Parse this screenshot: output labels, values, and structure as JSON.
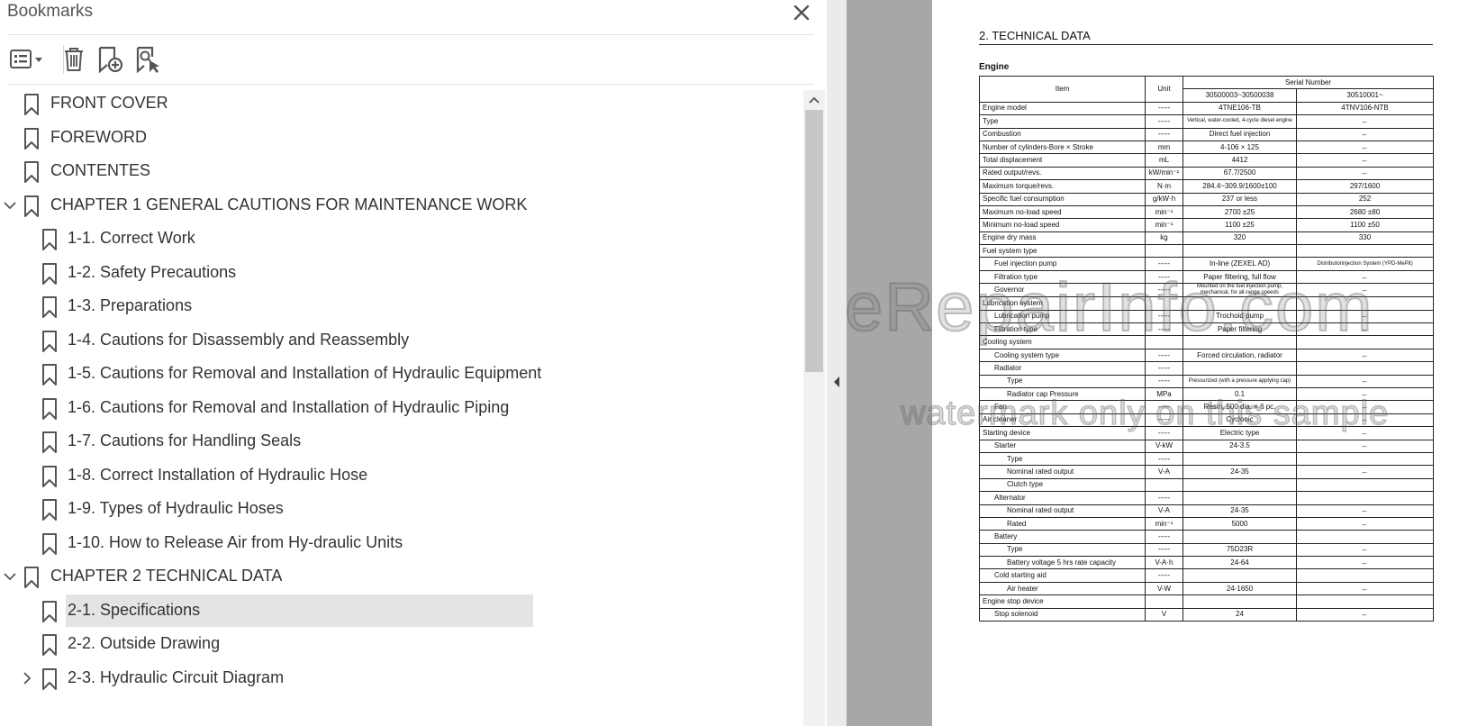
{
  "panel": {
    "title": "Bookmarks",
    "toolbar": {
      "options_icon": "bookmark-options-icon",
      "delete_icon": "trash-icon",
      "add_icon": "add-bookmark-icon",
      "find_icon": "find-current-bookmark-icon"
    },
    "items": [
      {
        "label": "FRONT COVER",
        "level": 0,
        "expander": "none",
        "selected": false
      },
      {
        "label": "FOREWORD",
        "level": 0,
        "expander": "none",
        "selected": false
      },
      {
        "label": "CONTENTES",
        "level": 0,
        "expander": "none",
        "selected": false
      },
      {
        "label": "CHAPTER 1 GENERAL CAUTIONS FOR MAINTENANCE WORK",
        "level": 0,
        "expander": "expanded",
        "selected": false
      },
      {
        "label": "1-1. Correct Work",
        "level": 1,
        "expander": "none",
        "selected": false
      },
      {
        "label": "1-2. Safety Precautions",
        "level": 1,
        "expander": "none",
        "selected": false
      },
      {
        "label": "1-3. Preparations",
        "level": 1,
        "expander": "none",
        "selected": false
      },
      {
        "label": "1-4. Cautions for Disassembly and Reassembly",
        "level": 1,
        "expander": "none",
        "selected": false
      },
      {
        "label": "1-5. Cautions for Removal and Installation of Hydraulic Equipment",
        "level": 1,
        "expander": "none",
        "selected": false
      },
      {
        "label": "1-6. Cautions for Removal and Installation of Hydraulic Piping",
        "level": 1,
        "expander": "none",
        "selected": false
      },
      {
        "label": "1-7. Cautions for Handling Seals",
        "level": 1,
        "expander": "none",
        "selected": false
      },
      {
        "label": "1-8. Correct Installation of Hydraulic Hose",
        "level": 1,
        "expander": "none",
        "selected": false
      },
      {
        "label": "1-9. Types of Hydraulic Hoses",
        "level": 1,
        "expander": "none",
        "selected": false
      },
      {
        "label": "1-10. How to Release Air from Hy-draulic Units",
        "level": 1,
        "expander": "none",
        "selected": false
      },
      {
        "label": "CHAPTER 2 TECHNICAL DATA",
        "level": 0,
        "expander": "expanded",
        "selected": false
      },
      {
        "label": "2-1. Specifications",
        "level": 1,
        "expander": "none",
        "selected": true
      },
      {
        "label": "2-2. Outside Drawing",
        "level": 1,
        "expander": "none",
        "selected": false
      },
      {
        "label": "2-3. Hydraulic Circuit Diagram",
        "level": 1,
        "expander": "collapsed",
        "selected": false
      }
    ]
  },
  "document": {
    "heading": "2. TECHNICAL DATA",
    "section": "Engine",
    "header": {
      "item": "Item",
      "unit": "Unit",
      "serial": "Serial Number",
      "serial_a": "30500003~30500038",
      "serial_b": "30510001~"
    },
    "rows": [
      {
        "item": "Engine model",
        "indent": 0,
        "unit": "-----",
        "a": "4TNE106-TB",
        "b": "4TNV106-NTB"
      },
      {
        "item": "Type",
        "indent": 0,
        "unit": "-----",
        "a": "Vertical, water-cooled, 4-cycle diesel engine",
        "b": "←",
        "a_small": true
      },
      {
        "item": "Combustion",
        "indent": 0,
        "unit": "-----",
        "a": "Direct fuel injection",
        "b": "←"
      },
      {
        "item": "Number of cylinders-Bore × Stroke",
        "indent": 0,
        "unit": "mm",
        "a": "4-106 × 125",
        "b": "←"
      },
      {
        "item": "Total displacement",
        "indent": 0,
        "unit": "mL",
        "a": "4412",
        "b": "←"
      },
      {
        "item": "Rated output/revs.",
        "indent": 0,
        "unit": "kW/min⁻¹",
        "a": "67.7/2500",
        "b": "←"
      },
      {
        "item": "Maximum torque/revs.",
        "indent": 0,
        "unit": "N·m",
        "a": "284.4~309.9/1600±100",
        "b": "297/1600"
      },
      {
        "item": "Specific fuel consumption",
        "indent": 0,
        "unit": "g/kW·h",
        "a": "237 or less",
        "b": "252"
      },
      {
        "item": "Maximum no-load speed",
        "indent": 0,
        "unit": "min⁻¹",
        "a": "2700 ±25",
        "b": "2680 ±80"
      },
      {
        "item": "Minimum no-load speed",
        "indent": 0,
        "unit": "min⁻¹",
        "a": "1100 ±25",
        "b": "1100 ±50"
      },
      {
        "item": "Engine dry mass",
        "indent": 0,
        "unit": "kg",
        "a": "320",
        "b": "330"
      },
      {
        "item": "Fuel system type",
        "indent": 0,
        "unit": "",
        "a": "",
        "b": "",
        "span": true
      },
      {
        "item": "Fuel injection pump",
        "indent": 1,
        "unit": "-----",
        "a": "In-line (ZEXEL AD)",
        "b": "Distributorinjection System (YPD-MePit)",
        "b_small": true
      },
      {
        "item": "Filtration type",
        "indent": 1,
        "unit": "-----",
        "a": "Paper filtering, full flow",
        "b": "←"
      },
      {
        "item": "Governor",
        "indent": 1,
        "unit": "-----",
        "a": "Mounted on the fuel injection pump, mechanical, for all-range speeds",
        "b": "←",
        "a_small": true
      },
      {
        "item": "Lubrication system",
        "indent": 0,
        "unit": "",
        "a": "",
        "b": "",
        "span": true
      },
      {
        "item": "Lubrication pump",
        "indent": 1,
        "unit": "-----",
        "a": "Trochoid pump",
        "b": "←"
      },
      {
        "item": "Filtration type",
        "indent": 1,
        "unit": "-----",
        "a": "Paper filtering",
        "b": "←"
      },
      {
        "item": "Cooling system",
        "indent": 0,
        "unit": "",
        "a": "",
        "b": "",
        "span": true
      },
      {
        "item": "Cooling system type",
        "indent": 1,
        "unit": "-----",
        "a": "Forced circulation, radiator",
        "b": "←"
      },
      {
        "item": "Radiator",
        "indent": 1,
        "unit": "-----",
        "a": "",
        "b": ""
      },
      {
        "item": "Type",
        "indent": 2,
        "unit": "-----",
        "a": "Pressurized (with a pressure applying cap)",
        "b": "←",
        "a_small": true
      },
      {
        "item": "Radiator cap Pressure",
        "indent": 2,
        "unit": "MPa",
        "a": "0.1",
        "b": "←"
      },
      {
        "item": "Fan",
        "indent": 1,
        "unit": "-----",
        "a": "Resin, 500 dia. × 6 pc.",
        "b": "←"
      },
      {
        "item": "Air cleaner",
        "indent": 0,
        "unit": "-----",
        "a": "Cyclonic",
        "b": "←"
      },
      {
        "item": "Starting device",
        "indent": 0,
        "unit": "-----",
        "a": "Electric type",
        "b": "←"
      },
      {
        "item": "Starter",
        "indent": 1,
        "unit": "V-kW",
        "a": "24-3.5",
        "b": "←"
      },
      {
        "item": "Type",
        "indent": 2,
        "unit": "-----",
        "a": "",
        "b": ""
      },
      {
        "item": "Nominal rated output",
        "indent": 2,
        "unit": "V-A",
        "a": "24-35",
        "b": "←"
      },
      {
        "item": "Clutch type",
        "indent": 2,
        "unit": "",
        "a": "",
        "b": ""
      },
      {
        "item": "Alternator",
        "indent": 1,
        "unit": "-----",
        "a": "",
        "b": ""
      },
      {
        "item": "Nominal rated output",
        "indent": 2,
        "unit": "V-A",
        "a": "24-35",
        "b": "←"
      },
      {
        "item": "Rated",
        "indent": 2,
        "unit": "min⁻¹",
        "a": "5000",
        "b": "←"
      },
      {
        "item": "Battery",
        "indent": 1,
        "unit": "-----",
        "a": "",
        "b": ""
      },
      {
        "item": "Type",
        "indent": 2,
        "unit": "-----",
        "a": "75D23R",
        "b": "←"
      },
      {
        "item": "Battery voltage 5 hrs rate capacity",
        "indent": 2,
        "unit": "V-A·h",
        "a": "24-64",
        "b": "←"
      },
      {
        "item": "Cold starting aid",
        "indent": 1,
        "unit": "-----",
        "a": "",
        "b": ""
      },
      {
        "item": "Air heater",
        "indent": 2,
        "unit": "V-W",
        "a": "24-1650",
        "b": "←"
      },
      {
        "item": "Engine stop device",
        "indent": 0,
        "unit": "",
        "a": "",
        "b": "",
        "span": true
      },
      {
        "item": "Stop solenoid",
        "indent": 1,
        "unit": "V",
        "a": "24",
        "b": "←"
      }
    ],
    "watermark_main": "eRepairInfo.com",
    "watermark_sub": "watermark only on this sample"
  }
}
